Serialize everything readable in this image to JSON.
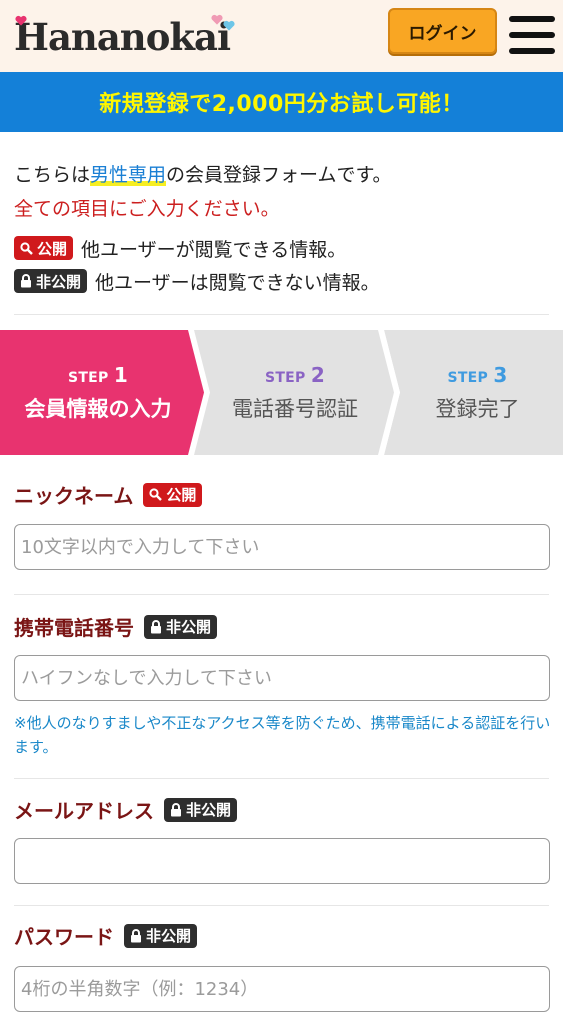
{
  "header": {
    "logo_text": "Hananokai",
    "login_label": "ログイン"
  },
  "banner": {
    "text": "新規登録で2,000円分お試し可能！"
  },
  "intro": {
    "line1_prefix": "こちらは",
    "line1_highlight": "男性専用",
    "line1_suffix": "の会員登録フォームです。",
    "line2": "全ての項目にご入力ください。",
    "public_badge": "公開",
    "public_desc": "他ユーザーが閲覧できる情報。",
    "private_badge": "非公開",
    "private_desc": "他ユーザーは閲覧できない情報。"
  },
  "steps": [
    {
      "label": "STEP",
      "num": "1",
      "name": "会員情報の入力",
      "active": true
    },
    {
      "label": "STEP",
      "num": "2",
      "name": "電話番号認証",
      "active": false
    },
    {
      "label": "STEP",
      "num": "3",
      "name": "登録完了",
      "active": false
    }
  ],
  "colors": {
    "accent_pink": "#e8336f",
    "step2_purple": "#8a63c4",
    "step3_blue": "#3f9be0",
    "banner_blue": "#1480d8",
    "banner_text": "#fff600"
  },
  "form": {
    "nickname": {
      "label": "ニックネーム",
      "badge": "公開",
      "placeholder": "10文字以内で入力して下さい"
    },
    "phone": {
      "label": "携帯電話番号",
      "badge": "非公開",
      "placeholder": "ハイフンなしで入力して下さい",
      "note": "※他人のなりすましや不正なアクセス等を防ぐため、携帯電話による認証を行います。"
    },
    "email": {
      "label": "メールアドレス",
      "badge": "非公開",
      "placeholder": ""
    },
    "password": {
      "label": "パスワード",
      "badge": "非公開",
      "placeholder": "4桁の半角数字（例：1234）"
    }
  }
}
